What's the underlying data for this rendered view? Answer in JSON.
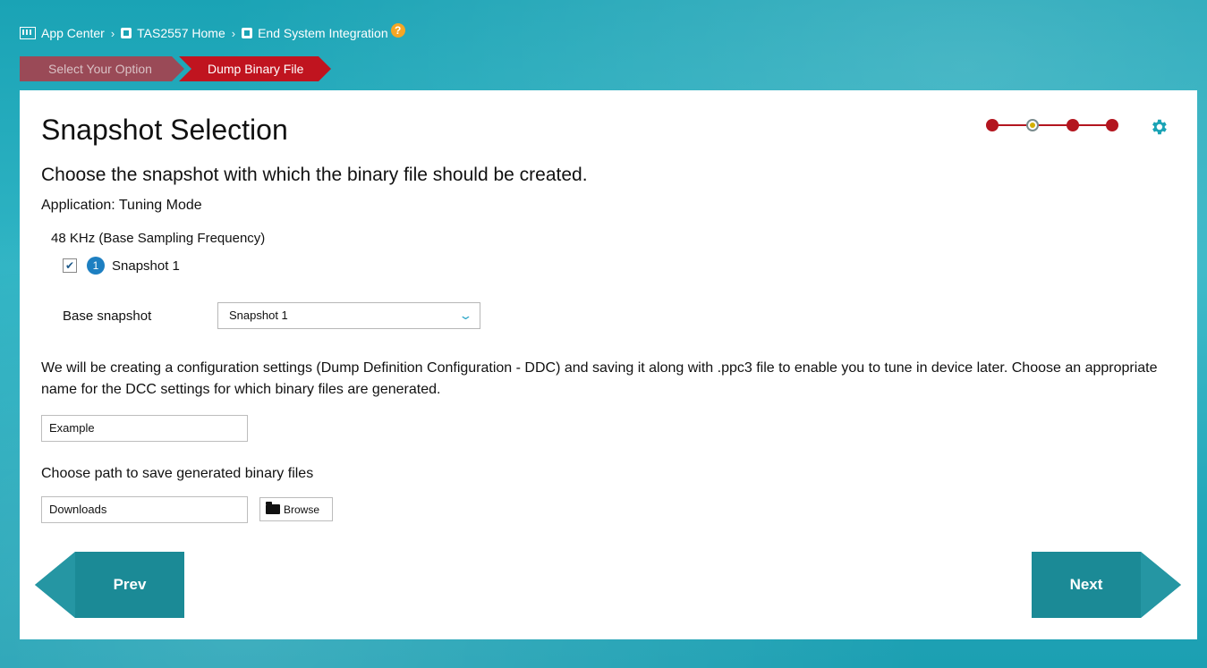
{
  "breadcrumb": {
    "items": [
      "App Center",
      "TAS2557 Home",
      "End System Integration"
    ],
    "separator": "›",
    "help": "?"
  },
  "steps": [
    "Select Your Option",
    "Dump Binary File"
  ],
  "page": {
    "title": "Snapshot Selection",
    "subtitle": "Choose the snapshot with which the binary file should be created.",
    "application": "Application: Tuning Mode",
    "frequency": "48 KHz (Base Sampling Frequency)",
    "snapshot": {
      "checked": true,
      "number": "1",
      "label": "Snapshot 1"
    },
    "base_snapshot_label": "Base snapshot",
    "base_snapshot_value": "Snapshot 1",
    "description": "We will be creating a configuration settings (Dump Definition Configuration - DDC) and saving it along with .ppc3 file to enable you to tune in device later. Choose an appropriate name for the DCC settings for which binary files are generated.",
    "ddc_name": "Example",
    "path_label": "Choose path to save generated binary files",
    "path_value": "Downloads",
    "browse": "Browse"
  },
  "nav": {
    "prev": "Prev",
    "next": "Next"
  },
  "colors": {
    "accent": "#1aa3b5",
    "step_active": "#c0141f",
    "nav": "#1b8a96"
  },
  "progress": {
    "total_steps": 4,
    "current_step": 2
  }
}
